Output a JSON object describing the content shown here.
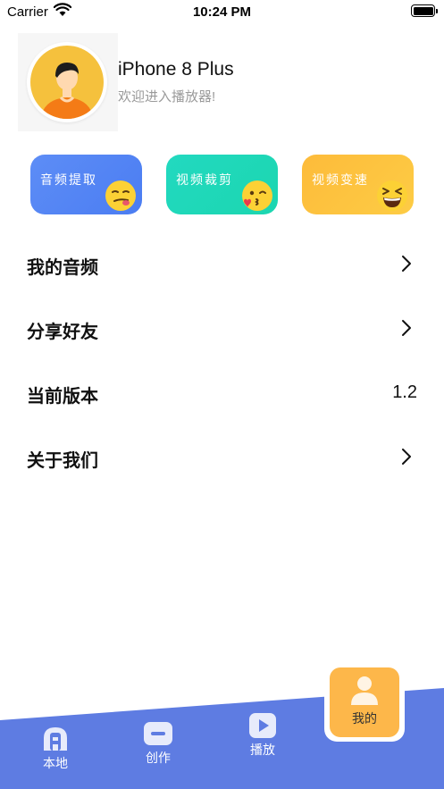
{
  "status_bar": {
    "carrier": "Carrier",
    "time": "10:24 PM"
  },
  "profile": {
    "name": "iPhone 8 Plus",
    "subtitle": "欢迎进入播放器!"
  },
  "features": [
    {
      "label": "音频提取",
      "emoji_icon": "smirk-face-icon",
      "color": "#5088F4"
    },
    {
      "label": "视频裁剪",
      "emoji_icon": "kissing-face-icon",
      "color": "#22D8BE"
    },
    {
      "label": "视频变速",
      "emoji_icon": "laughing-face-icon",
      "color": "#FDC340"
    }
  ],
  "menu": [
    {
      "label": "我的音频",
      "value": "",
      "icon": "chevron-right-icon"
    },
    {
      "label": "分享好友",
      "value": "",
      "icon": "chevron-right-icon"
    },
    {
      "label": "当前版本",
      "value": "1.2"
    },
    {
      "label": "关于我们",
      "value": "",
      "icon": "chevron-right-icon"
    }
  ],
  "tabs": [
    {
      "label": "本地",
      "icon": "local-a-icon"
    },
    {
      "label": "创作",
      "icon": "create-minus-icon"
    },
    {
      "label": "播放",
      "icon": "play-icon"
    },
    {
      "label": "我的",
      "icon": "person-icon",
      "selected": true
    }
  ],
  "colors": {
    "tabbar": "#5E7CE2",
    "selected_tab": "#FDB74A",
    "card_audio": "#5088F4",
    "card_clip": "#22D8BE",
    "card_speed": "#FDC340"
  }
}
